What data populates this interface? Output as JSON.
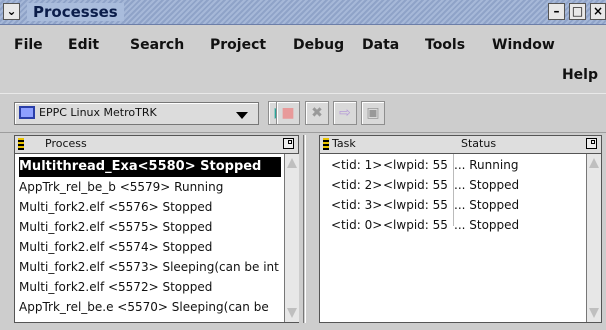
{
  "window": {
    "title": "Processes"
  },
  "menu": {
    "items": [
      {
        "label": "File"
      },
      {
        "label": "Edit"
      },
      {
        "label": "Search"
      },
      {
        "label": "Project"
      },
      {
        "label": "Debug"
      },
      {
        "label": "Data"
      },
      {
        "label": "Tools"
      },
      {
        "label": "Window"
      }
    ],
    "help": "Help"
  },
  "toolbar": {
    "target": "EPPC Linux MetroTRK"
  },
  "process_panel": {
    "header": "Process",
    "rows": [
      {
        "text": "Multithread_Exa<5580> Stopped",
        "selected": true
      },
      {
        "text": "AppTrk_rel_be_b <5579> Running"
      },
      {
        "text": "Multi_fork2.elf <5576> Stopped"
      },
      {
        "text": "Multi_fork2.elf <5575> Stopped"
      },
      {
        "text": "Multi_fork2.elf <5574> Stopped"
      },
      {
        "text": "Multi_fork2.elf <5573> Sleeping(can be int"
      },
      {
        "text": "Multi_fork2.elf <5572> Stopped"
      },
      {
        "text": "AppTrk_rel_be.e <5570> Sleeping(can be"
      }
    ]
  },
  "task_panel": {
    "headers": {
      "task": "Task",
      "status": "Status"
    },
    "rows": [
      {
        "tid": "<tid: 1>",
        "lwpid": "<lwpid: 55",
        "status": "... Running"
      },
      {
        "tid": "<tid: 2>",
        "lwpid": "<lwpid: 55",
        "status": "... Stopped"
      },
      {
        "tid": "<tid: 3>",
        "lwpid": "<lwpid: 55",
        "status": "... Stopped"
      },
      {
        "tid": "<tid: 0>",
        "lwpid": "<lwpid: 55",
        "status": "... Stopped"
      }
    ]
  }
}
